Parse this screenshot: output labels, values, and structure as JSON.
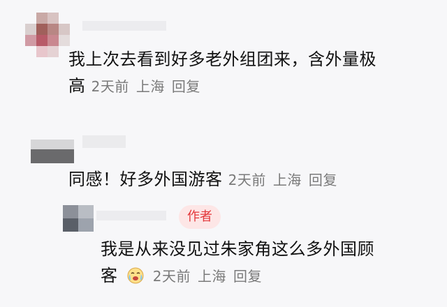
{
  "comments": [
    {
      "text_line1": "我上次去看到好多老外组团来，含外量极",
      "text_line2": "高",
      "time": "2天前",
      "location": "上海",
      "reply_label": "回复"
    },
    {
      "text": "同感！好多外国游客",
      "time": "2天前",
      "location": "上海",
      "reply_label": "回复"
    },
    {
      "author_badge": "作者",
      "text_line1": "我是从来没见过朱家角这么多外国顾",
      "text_line2": "客",
      "emoji": "crying-face-icon",
      "time": "2天前",
      "location": "上海",
      "reply_label": "回复"
    }
  ],
  "colors": {
    "badge_bg": "#fde6e6",
    "badge_text": "#e3373a",
    "meta_text": "#7a7a7a"
  }
}
